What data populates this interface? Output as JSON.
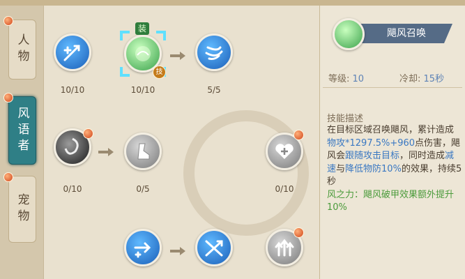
{
  "tabs": [
    {
      "label": "人物",
      "active": false
    },
    {
      "label": "风语者",
      "active": true
    },
    {
      "label": "宠物",
      "active": false
    }
  ],
  "skills": {
    "row1": [
      {
        "name": "skill-1-1",
        "icon": "sword-plus-icon",
        "level": "10/10"
      },
      {
        "name": "skill-1-2",
        "icon": "green-orb-icon",
        "level": "10/10",
        "equip_badge": "装",
        "skill_badge": "技"
      },
      {
        "name": "skill-1-3",
        "icon": "whirlwind-icon",
        "level": "5/5"
      }
    ],
    "row2": [
      {
        "name": "skill-2-1",
        "icon": "dark-vortex-icon",
        "level": "0/10"
      },
      {
        "name": "skill-2-2",
        "icon": "gray-boot-icon",
        "level": "0/5"
      },
      {
        "name": "skill-2-3",
        "icon": "heart-plus-icon",
        "level": "0/10"
      }
    ],
    "row3": [
      {
        "name": "skill-3-1",
        "icon": "arrow-plus-icon"
      },
      {
        "name": "skill-3-2",
        "icon": "crossed-arrows-icon"
      },
      {
        "name": "skill-3-3",
        "icon": "triple-up-arrows-icon"
      }
    ]
  },
  "info": {
    "skill_name": "飓风召唤",
    "level_label": "等级:",
    "level_value": "10",
    "cooldown_label": "冷却:",
    "cooldown_value": "15秒",
    "desc_title": "技能描述",
    "desc": {
      "p1": "在目标区域召唤飓风，累计造成",
      "p2": "物攻*1297.5%+960",
      "p3": "点伤害，飓风会",
      "p4": "跟随攻击目标",
      "p5": "，同时造成",
      "p6": "减速",
      "p7": "与",
      "p8": "降低物防10%",
      "p9": "的效果，持续5秒",
      "p10": "风之力：飓风破甲效果额外提升10%"
    }
  },
  "colors": {
    "accent": "#2f7f86",
    "highlight": "#3a78c2",
    "bonus": "#4b9b3b"
  }
}
